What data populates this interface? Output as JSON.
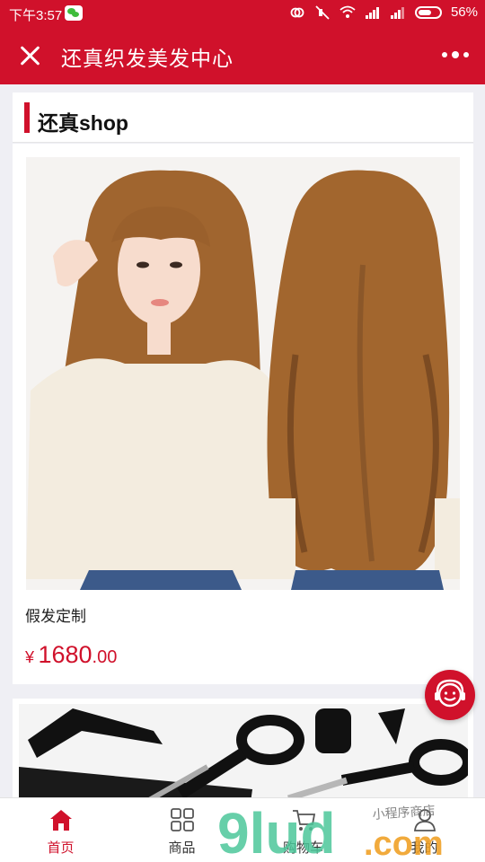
{
  "status_bar": {
    "time": "下午3:57",
    "battery": "56%"
  },
  "header": {
    "title": "还真织发美发中心"
  },
  "shop": {
    "name": "还真shop"
  },
  "product": {
    "title": "假发定制",
    "currency": "¥",
    "price_int": "1680",
    "price_dec": ".00"
  },
  "tabs": [
    {
      "label": "首页",
      "icon": "home-icon",
      "active": true
    },
    {
      "label": "商品",
      "icon": "grid-icon",
      "active": false
    },
    {
      "label": "购物车",
      "icon": "cart-icon",
      "active": false
    },
    {
      "label": "我的",
      "icon": "user-icon",
      "active": false
    }
  ],
  "watermark": {
    "logo": "9lud",
    "domain": ".com",
    "tagline": "小程序商店"
  },
  "colors": {
    "brand": "#d0112b",
    "background": "#efeff4"
  }
}
